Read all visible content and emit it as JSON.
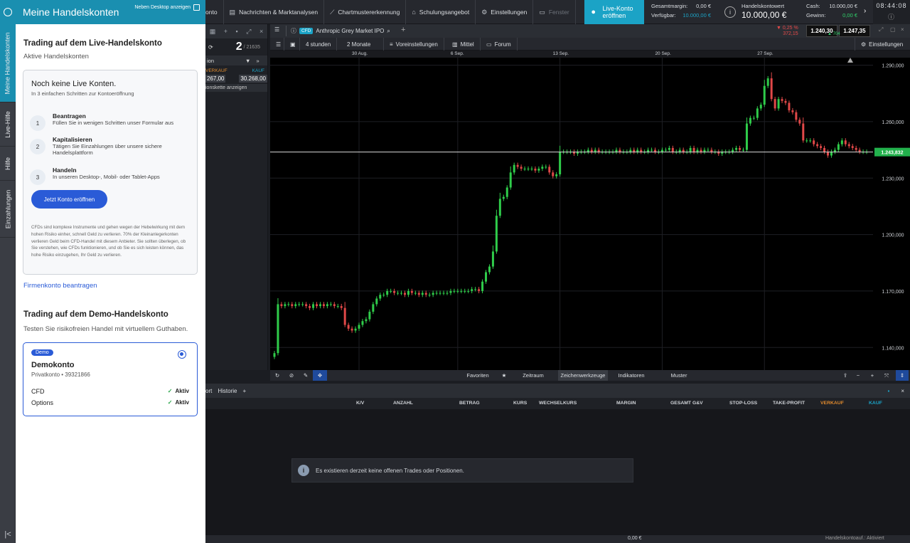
{
  "rail": {
    "tabs": [
      "Meine Handelskonten",
      "Live-Hilfe",
      "Hilfe",
      "Einzahlungen"
    ],
    "collapse_icon": "collapse-left-icon"
  },
  "panel": {
    "title": "Meine Handelskonten",
    "desktop_toggle_label": "Neben Desktop anzeigen",
    "live_section": {
      "title": "Trading auf dem Live-Handelskonto",
      "subtitle": "Aktive Handelskonten"
    },
    "live_card": {
      "title": "Noch keine Live Konten.",
      "hint": "In 3 einfachen Schritten zur Kontoeröffnung",
      "steps": [
        {
          "num": "1",
          "title": "Beantragen",
          "desc": "Füllen Sie in wenigen Schritten unser Formular aus"
        },
        {
          "num": "2",
          "title": "Kapitalisieren",
          "desc": "Tätigen Sie Einzahlungen über unsere sichere Handelsplattform"
        },
        {
          "num": "3",
          "title": "Handeln",
          "desc": "In unseren Desktop-, Mobil- oder Tablet-Apps"
        }
      ],
      "cta_label": "Jetzt Konto eröffnen",
      "disclaimer": "CFDs sind komplexe Instrumente und gehen wegen der Hebelwirkung mit dem hohen Risiko einher, schnell Geld zu verlieren. 70% der Kleinanlegerkonten verlieren Geld beim CFD-Handel mit diesem Anbieter. Sie sollten überlegen, ob Sie verstehen, wie CFDs funktionieren, und ob Sie es sich leisten können, das hohe Risiko einzugehen, Ihr Geld zu verlieren."
    },
    "company_link": "Firmenkonto beantragen",
    "demo_section": {
      "title": "Trading auf dem Demo-Handelskonto",
      "subtitle": "Testen Sie risikofreien Handel mit virtuellem Guthaben."
    },
    "demo_card": {
      "badge": "Demo",
      "name": "Demokonto",
      "account": "Privatkonto • 39321866",
      "products": [
        {
          "name": "CFD",
          "status": "Aktiv"
        },
        {
          "name": "Options",
          "status": "Aktiv"
        }
      ]
    }
  },
  "topbar": {
    "menu": [
      {
        "label": "onto",
        "icon": ""
      },
      {
        "label": "Nachrichten & Marktanalysen",
        "icon": "news-icon"
      },
      {
        "label": "Chartmustererkennung",
        "icon": "pattern-icon"
      },
      {
        "label": "Schulungsangebot",
        "icon": "graduation-icon"
      },
      {
        "label": "Einstellungen",
        "icon": "gear-icon"
      },
      {
        "label": "Fenster",
        "icon": "window-icon"
      }
    ],
    "live_button": "Live-Konto eröffnen",
    "margin_label": "Gesamtmargin:",
    "margin_value": "0,00 €",
    "available_label": "Verfügbar:",
    "available_value": "10.000,00 €",
    "account_value_label": "Handelskontowert",
    "account_value": "10.000,00 €",
    "cash_label": "Cash:",
    "cash_value": "10.000,00 €",
    "profit_label": "Gewinn:",
    "profit_value": "0,00 €",
    "time": "08:44:08"
  },
  "watch": {
    "count": "2",
    "total": "/ 21635",
    "select_label": "ion",
    "sell_label": "VERKAUF",
    "buy_label": "KAUF",
    "sell_price": "267,00",
    "buy_price": "30.268,00",
    "chain_label": "ionskette anzeigen"
  },
  "chart": {
    "tag": "CFD",
    "instrument": "Anthropic Grey Market IPO",
    "change_pct": "▼ 0,25 %",
    "change_abs": "372,15",
    "sell_price": "1.240,30",
    "spread": "704",
    "buy_price": "1.247,35",
    "toolbar": {
      "interval": "4 stunden",
      "range": "2 Monate",
      "presets": "Voreinstellungen",
      "mode": "Mittel",
      "forum": "Forum",
      "settings": "Einstellungen"
    },
    "footer": {
      "favorites": "Favoriten",
      "period": "Zeitraum",
      "drawing": "Zeichenwerkzeuge",
      "indicators": "Indikatoren",
      "patterns": "Muster"
    }
  },
  "chart_data": {
    "type": "candlestick",
    "x_ticks": [
      "30 Aug.",
      "6 Sep.",
      "13 Sep.",
      "20 Sep.",
      "27 Sep."
    ],
    "y_ticks": [
      "1.290,000",
      "1.260,000",
      "1.230,000",
      "1.200,000",
      "1.170,000",
      "1.140,000"
    ],
    "ylim": [
      1128,
      1294
    ],
    "current_price": 1243.832,
    "current_price_label": "1.243,832",
    "closes": [
      1137,
      1163,
      1162,
      1163,
      1163,
      1162,
      1163,
      1163,
      1163,
      1162,
      1161,
      1163,
      1162,
      1163,
      1162,
      1163,
      1163,
      1162,
      1162,
      1161,
      1152,
      1150,
      1149,
      1150,
      1152,
      1154,
      1155,
      1159,
      1163,
      1166,
      1168,
      1168,
      1170,
      1170,
      1169,
      1169,
      1169,
      1168,
      1170,
      1169,
      1169,
      1168,
      1169,
      1168,
      1168,
      1169,
      1169,
      1169,
      1169,
      1169,
      1170,
      1170,
      1170,
      1170,
      1170,
      1170,
      1171,
      1171,
      1170,
      1175,
      1180,
      1183,
      1191,
      1210,
      1219,
      1220,
      1225,
      1233,
      1237,
      1236,
      1235,
      1235,
      1235,
      1235,
      1234,
      1235,
      1236,
      1236,
      1233,
      1231,
      1232,
      1244,
      1244,
      1244,
      1244,
      1243,
      1244,
      1244,
      1244,
      1245,
      1244,
      1245,
      1244,
      1244,
      1244,
      1244,
      1244,
      1245,
      1244,
      1244,
      1244,
      1245,
      1244,
      1245,
      1244,
      1244,
      1245,
      1245,
      1244,
      1244,
      1245,
      1245,
      1246,
      1244,
      1244,
      1245,
      1244,
      1244,
      1246,
      1244,
      1245,
      1244,
      1245,
      1245,
      1244,
      1244,
      1243,
      1244,
      1244,
      1244,
      1245,
      1246,
      1245,
      1245,
      1259,
      1262,
      1262,
      1267,
      1269,
      1279,
      1283,
      1272,
      1267,
      1272,
      1271,
      1270,
      1266,
      1265,
      1261,
      1259,
      1250,
      1250,
      1250,
      1248,
      1247,
      1246,
      1244,
      1242,
      1244,
      1245,
      1248,
      1250,
      1248,
      1247,
      1246,
      1245,
      1244,
      1244,
      1244
    ]
  },
  "positions": {
    "tabs": [
      "ort",
      "Historie"
    ],
    "columns": [
      "K/V",
      "ANZAHL",
      "BETRAG",
      "KURS",
      "WECHSELKURS",
      "MARGIN",
      "GESAMT G&V",
      "STOP-LOSS",
      "TAKE-PROFIT",
      "VERKAUF",
      "KAUF"
    ],
    "empty_message": "Es existieren derzeit keine offenen Trades oder Positionen."
  },
  "status": {
    "total": "0,00 €",
    "account_status": "Handelskontoauf.: Aktiviert"
  }
}
